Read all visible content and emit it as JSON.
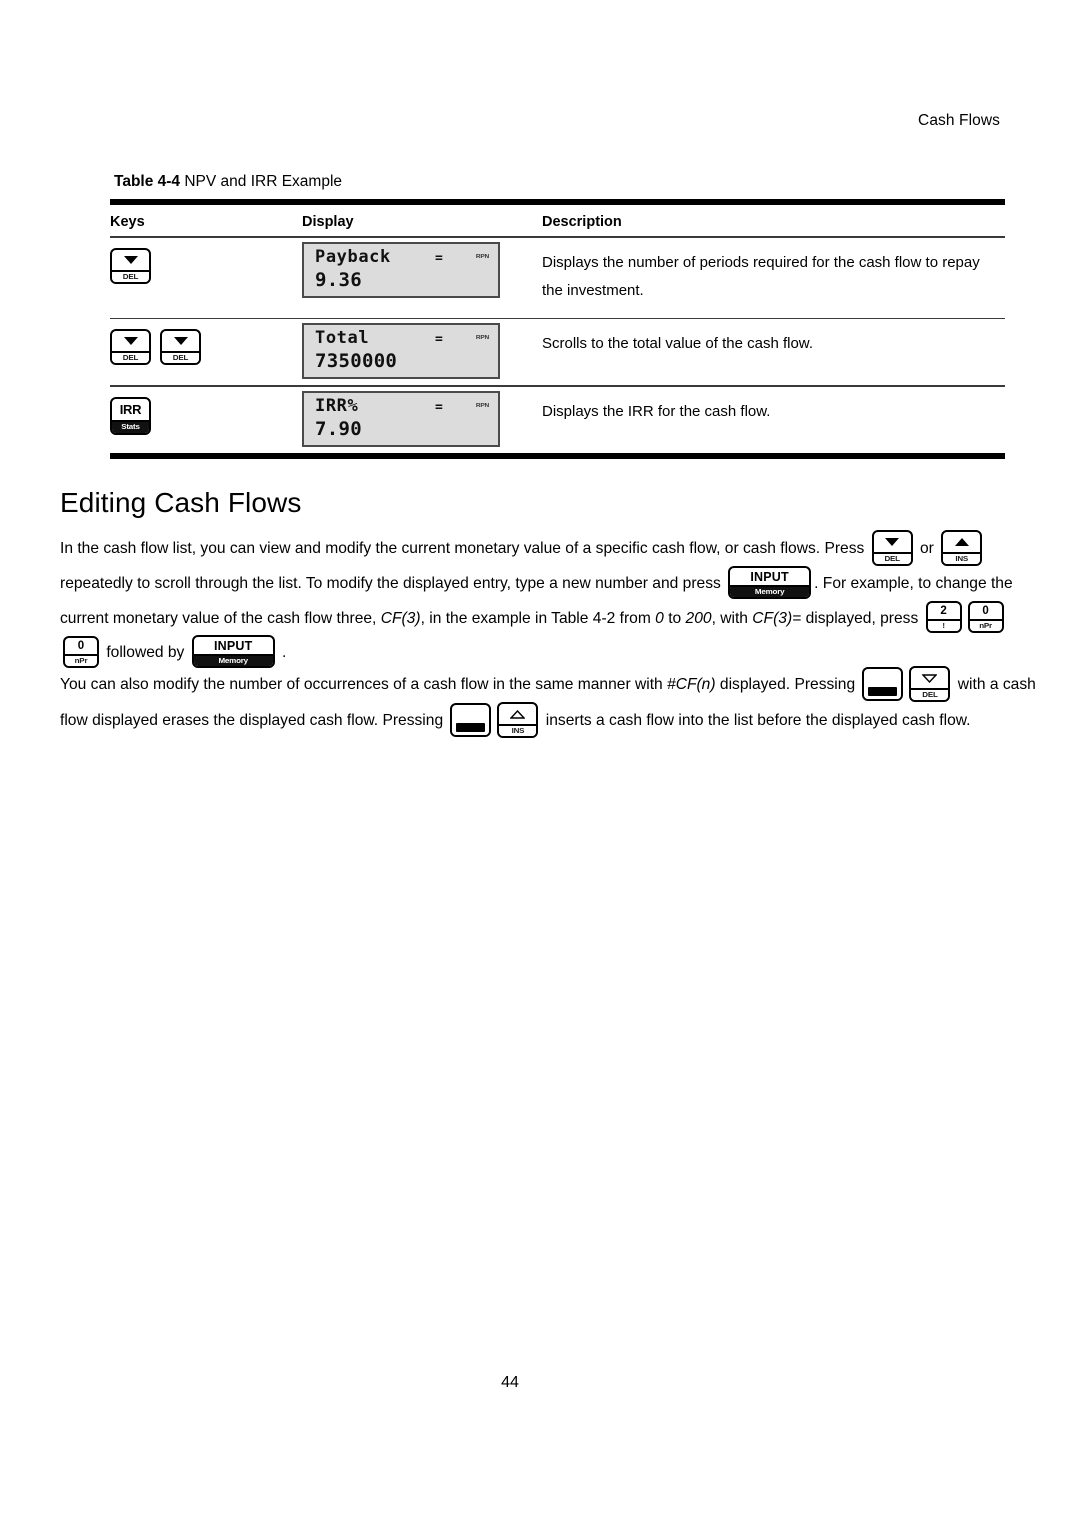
{
  "header": {
    "running_title": "Cash Flows"
  },
  "page_number": "44",
  "table": {
    "caption_number": "Table 4-4",
    "caption_text": " NPV and IRR Example",
    "columns": {
      "keys": "Keys",
      "display": "Display",
      "description": "Description"
    },
    "rows": [
      {
        "keys": [
          {
            "type": "arrow-down-solid",
            "sublabel": "DEL"
          }
        ],
        "display": {
          "line1": "Payback",
          "equals": "=",
          "annunciator": "RPN",
          "line2": "9.36"
        },
        "description": "Displays the number of periods required for the cash flow to repay the investment."
      },
      {
        "keys": [
          {
            "type": "arrow-down-solid",
            "sublabel": "DEL"
          },
          {
            "type": "arrow-down-solid",
            "sublabel": "DEL"
          }
        ],
        "display": {
          "line1": "Total",
          "equals": "=",
          "annunciator": "RPN",
          "line2": "7350000"
        },
        "description": "Scrolls to the total value of the cash flow."
      },
      {
        "keys": [
          {
            "type": "label",
            "label": "IRR",
            "sublabel": "Stats"
          }
        ],
        "display": {
          "line1": "IRR%",
          "equals": "=",
          "annunciator": "RPN",
          "line2": "7.90"
        },
        "description": "Displays the IRR for the cash flow."
      }
    ]
  },
  "section": {
    "heading": "Editing Cash Flows",
    "paragraph1": {
      "seg1": "In the cash flow list, you can view and modify the current monetary value of a specific cash flow, or cash flows. Press ",
      "key1": {
        "type": "arrow-down-solid",
        "sublabel": "DEL"
      },
      "seg2": " or ",
      "key2": {
        "type": "arrow-up-solid",
        "sublabel": "INS"
      },
      "seg3": " repeatedly to scroll through the list. To modify the displayed entry, type a new number and press ",
      "key3": {
        "type": "label",
        "label": "INPUT",
        "sublabel": "Memory"
      },
      "seg4": ". For example, to change the current monetary value of the cash flow three, ",
      "em1": "CF(3)",
      "seg5": ", in the example in Table 4-2 from ",
      "em2": "0",
      "seg6": " to ",
      "em3": "200",
      "seg7": ", with ",
      "em4": "CF(3)=",
      "seg8": " displayed, press ",
      "key4": {
        "type": "label",
        "label": "2",
        "sublabel": "!"
      },
      "key5": {
        "type": "label",
        "label": "0",
        "sublabel": "nPr"
      },
      "key6": {
        "type": "label",
        "label": "0",
        "sublabel": "nPr"
      },
      "seg9": " followed by ",
      "key7": {
        "type": "label",
        "label": "INPUT",
        "sublabel": "Memory"
      },
      "seg10": " ."
    },
    "paragraph2": {
      "seg1": "You can also modify the number of occurrences of a cash flow in the same manner with ",
      "em1": "#CF(n)",
      "seg2": " displayed. Pressing ",
      "key1": {
        "type": "shift"
      },
      "key2": {
        "type": "arrow-down-hollow",
        "sublabel": "DEL"
      },
      "seg3": " with a cash flow displayed erases the displayed cash flow. Pressing ",
      "key3": {
        "type": "shift"
      },
      "key4": {
        "type": "arrow-up-hollow",
        "sublabel": "INS"
      },
      "seg4": " inserts a cash flow into the list before the displayed cash flow."
    }
  }
}
